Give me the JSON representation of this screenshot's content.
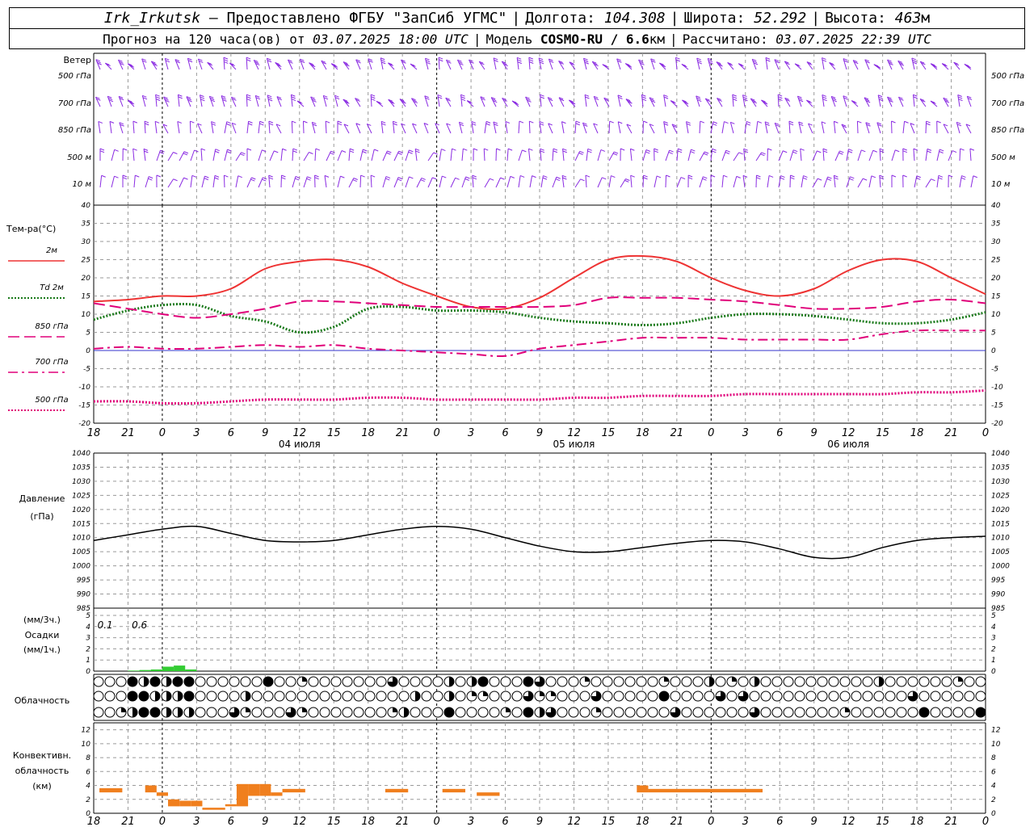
{
  "header": {
    "station": "Irk_Irkutsk",
    "provider": "– Предоставлено ФГБУ \"ЗапСиб УГМС\"",
    "lon_label": "Долгота:",
    "lon": "104.308",
    "lat_label": "Широта:",
    "lat": "52.292",
    "alt_label": "Высота:",
    "alt": "463",
    "alt_unit": "м",
    "forecast_label": "Прогноз на 120 часа(ов) от",
    "forecast_time": "03.07.2025 18:00 UTC",
    "model_label": "Модель",
    "model": "COSMO-RU / 6.6",
    "model_unit": "км",
    "calc_label": "Рассчитано:",
    "calc_time": "03.07.2025 22:39 UTC",
    "sep": "|"
  },
  "chart_data": [
    {
      "panel": "wind",
      "type": "table",
      "title": "Ветер",
      "levels": [
        "500 гПа",
        "700 гПа",
        "850 гПа",
        "500 м",
        "10  м"
      ],
      "colors": {
        "barb": "#8a2be2"
      }
    },
    {
      "panel": "temperature",
      "type": "line",
      "ylabel": "Тем-ра(°С)",
      "ylim": [
        -20,
        40
      ],
      "yticks": [
        -20,
        -15,
        -10,
        -5,
        0,
        5,
        10,
        15,
        20,
        25,
        30,
        35,
        40
      ],
      "x_hours": [
        0,
        3,
        6,
        9,
        12,
        15,
        18,
        21,
        24,
        27,
        30,
        33,
        36,
        39,
        42,
        45,
        48,
        51,
        54,
        57,
        60,
        63,
        66,
        69,
        72,
        75,
        78
      ],
      "series": [
        {
          "name": "2м",
          "color": "#ee3333",
          "style": "solid",
          "values": [
            13.5,
            14,
            15,
            15,
            17,
            22.5,
            24.5,
            25,
            23,
            18.5,
            15,
            12,
            11.5,
            14.5,
            20,
            25,
            26,
            24.5,
            20,
            16.5,
            15,
            17,
            22,
            25,
            24.5,
            20,
            15.5
          ]
        },
        {
          "name": "Td  2м",
          "color": "#1a7a1a",
          "style": "dotted",
          "values": [
            8.5,
            11,
            12.5,
            12.5,
            9.5,
            8,
            5,
            6.5,
            11.5,
            12,
            11,
            11,
            10.5,
            9,
            8,
            7.5,
            7,
            7.5,
            9,
            10,
            10,
            9.5,
            8.5,
            7.5,
            7.5,
            8.5,
            10.5
          ]
        },
        {
          "name": "850 гПа",
          "color": "#e0007a",
          "style": "dashed",
          "values": [
            13,
            11.5,
            10,
            9,
            10,
            11.5,
            13.5,
            13.5,
            13,
            12.5,
            12,
            12,
            12,
            12,
            12.5,
            14.5,
            14.5,
            14.5,
            14,
            13.5,
            12.5,
            11.5,
            11.5,
            12,
            13.5,
            14,
            13
          ]
        },
        {
          "name": "700 гПа",
          "color": "#e0007a",
          "style": "dashdot",
          "values": [
            0.5,
            1,
            0.5,
            0.5,
            1,
            1.5,
            1,
            1.5,
            0.5,
            0,
            -0.5,
            -1,
            -1.5,
            0.5,
            1.5,
            2.5,
            3.5,
            3.5,
            3.5,
            3,
            3,
            3,
            3,
            4.5,
            5.5,
            5.5,
            5.5
          ]
        },
        {
          "name": "500 гПа",
          "color": "#e0007a",
          "style": "dotted",
          "values": [
            -14,
            -14,
            -14.5,
            -14.5,
            -14,
            -13.5,
            -13.5,
            -13.5,
            -13,
            -13,
            -13.5,
            -13.5,
            -13.5,
            -13.5,
            -13,
            -13,
            -12.5,
            -12.5,
            -12.5,
            -12,
            -12,
            -12,
            -12,
            -12,
            -11.5,
            -11.5,
            -11
          ]
        }
      ]
    },
    {
      "panel": "time_axis",
      "type": "table",
      "tick_labels": [
        "18",
        "21",
        "0",
        "3",
        "6",
        "9",
        "12",
        "15",
        "18",
        "21",
        "0",
        "3",
        "6",
        "9",
        "12",
        "15",
        "18",
        "21",
        "0",
        "3",
        "6",
        "9",
        "12",
        "15",
        "18",
        "21",
        "0"
      ],
      "day_labels": [
        "04 июля",
        "05 июля",
        "06 июля"
      ]
    },
    {
      "panel": "pressure",
      "type": "line",
      "ylabel_1": "Давление",
      "ylabel_2": "(гПа)",
      "ylim": [
        985,
        1040
      ],
      "yticks": [
        985,
        990,
        995,
        1000,
        1005,
        1010,
        1015,
        1020,
        1025,
        1030,
        1035,
        1040
      ],
      "x_hours": [
        0,
        3,
        6,
        9,
        12,
        15,
        18,
        21,
        24,
        27,
        30,
        33,
        36,
        39,
        42,
        45,
        48,
        51,
        54,
        57,
        60,
        63,
        66,
        69,
        72,
        75,
        78
      ],
      "series": [
        {
          "name": "",
          "color": "#000000",
          "values": [
            1009,
            1011,
            1013,
            1014,
            1011.5,
            1009,
            1008.5,
            1009,
            1011,
            1013,
            1014,
            1013,
            1010,
            1007,
            1005,
            1005,
            1006.5,
            1008,
            1009,
            1008.5,
            1006,
            1003,
            1003,
            1006.5,
            1009,
            1010,
            1010.5
          ]
        }
      ]
    },
    {
      "panel": "precipitation",
      "type": "bar",
      "ylabel_1": "(мм/3ч.)",
      "ylabel_2": "Осадки",
      "ylabel_3": "(мм/1ч.)",
      "ylim": [
        0,
        5
      ],
      "yticks": [
        0,
        1,
        2,
        3,
        4,
        5
      ],
      "annotations": [
        "0.1",
        "0.6"
      ],
      "annotation_hours": [
        1,
        4
      ],
      "hours": [
        3.5,
        4.5,
        5.5,
        6.5,
        7.5,
        8.5
      ],
      "values": [
        0.05,
        0.1,
        0.15,
        0.4,
        0.5,
        0.15
      ],
      "color": "#33cc33"
    },
    {
      "panel": "cloudiness",
      "type": "table",
      "title": "Облачность",
      "rows": 3,
      "columns": 79
    },
    {
      "panel": "convective",
      "type": "bar",
      "ylabel_1": "Конвективн.",
      "ylabel_2": "облачность",
      "ylabel_3": "(км)",
      "ylim": [
        0,
        13
      ],
      "yticks": [
        0,
        2,
        4,
        6,
        8,
        10,
        12
      ],
      "color": "#f07f1e",
      "segments": [
        {
          "h0": 0.5,
          "h1": 2.5,
          "base": 3,
          "top": 3.6
        },
        {
          "h0": 4.5,
          "h1": 5.5,
          "base": 3,
          "top": 4
        },
        {
          "h0": 5.5,
          "h1": 6.5,
          "base": 2.5,
          "top": 3
        },
        {
          "h0": 6.5,
          "h1": 7.5,
          "base": 1,
          "top": 2
        },
        {
          "h0": 7.5,
          "h1": 8.5,
          "base": 1,
          "top": 1.8
        },
        {
          "h0": 8.5,
          "h1": 9.5,
          "base": 1,
          "top": 1.8
        },
        {
          "h0": 9.5,
          "h1": 11.5,
          "base": 0.5,
          "top": 0.8
        },
        {
          "h0": 11.5,
          "h1": 12.5,
          "base": 1,
          "top": 1.3
        },
        {
          "h0": 12.5,
          "h1": 13.5,
          "base": 1,
          "top": 4.2
        },
        {
          "h0": 13.5,
          "h1": 14.5,
          "base": 2.5,
          "top": 4.2
        },
        {
          "h0": 14.5,
          "h1": 15.5,
          "base": 2.5,
          "top": 4.2
        },
        {
          "h0": 15.5,
          "h1": 16.5,
          "base": 2.5,
          "top": 3
        },
        {
          "h0": 16.5,
          "h1": 18.5,
          "base": 3,
          "top": 3.5
        },
        {
          "h0": 25.5,
          "h1": 27.5,
          "base": 3,
          "top": 3.5
        },
        {
          "h0": 30.5,
          "h1": 32.5,
          "base": 3,
          "top": 3.5
        },
        {
          "h0": 33.5,
          "h1": 35.5,
          "base": 2.5,
          "top": 3
        },
        {
          "h0": 47.5,
          "h1": 48.5,
          "base": 3,
          "top": 4
        },
        {
          "h0": 48.5,
          "h1": 58.5,
          "base": 3,
          "top": 3.5
        }
      ]
    }
  ]
}
